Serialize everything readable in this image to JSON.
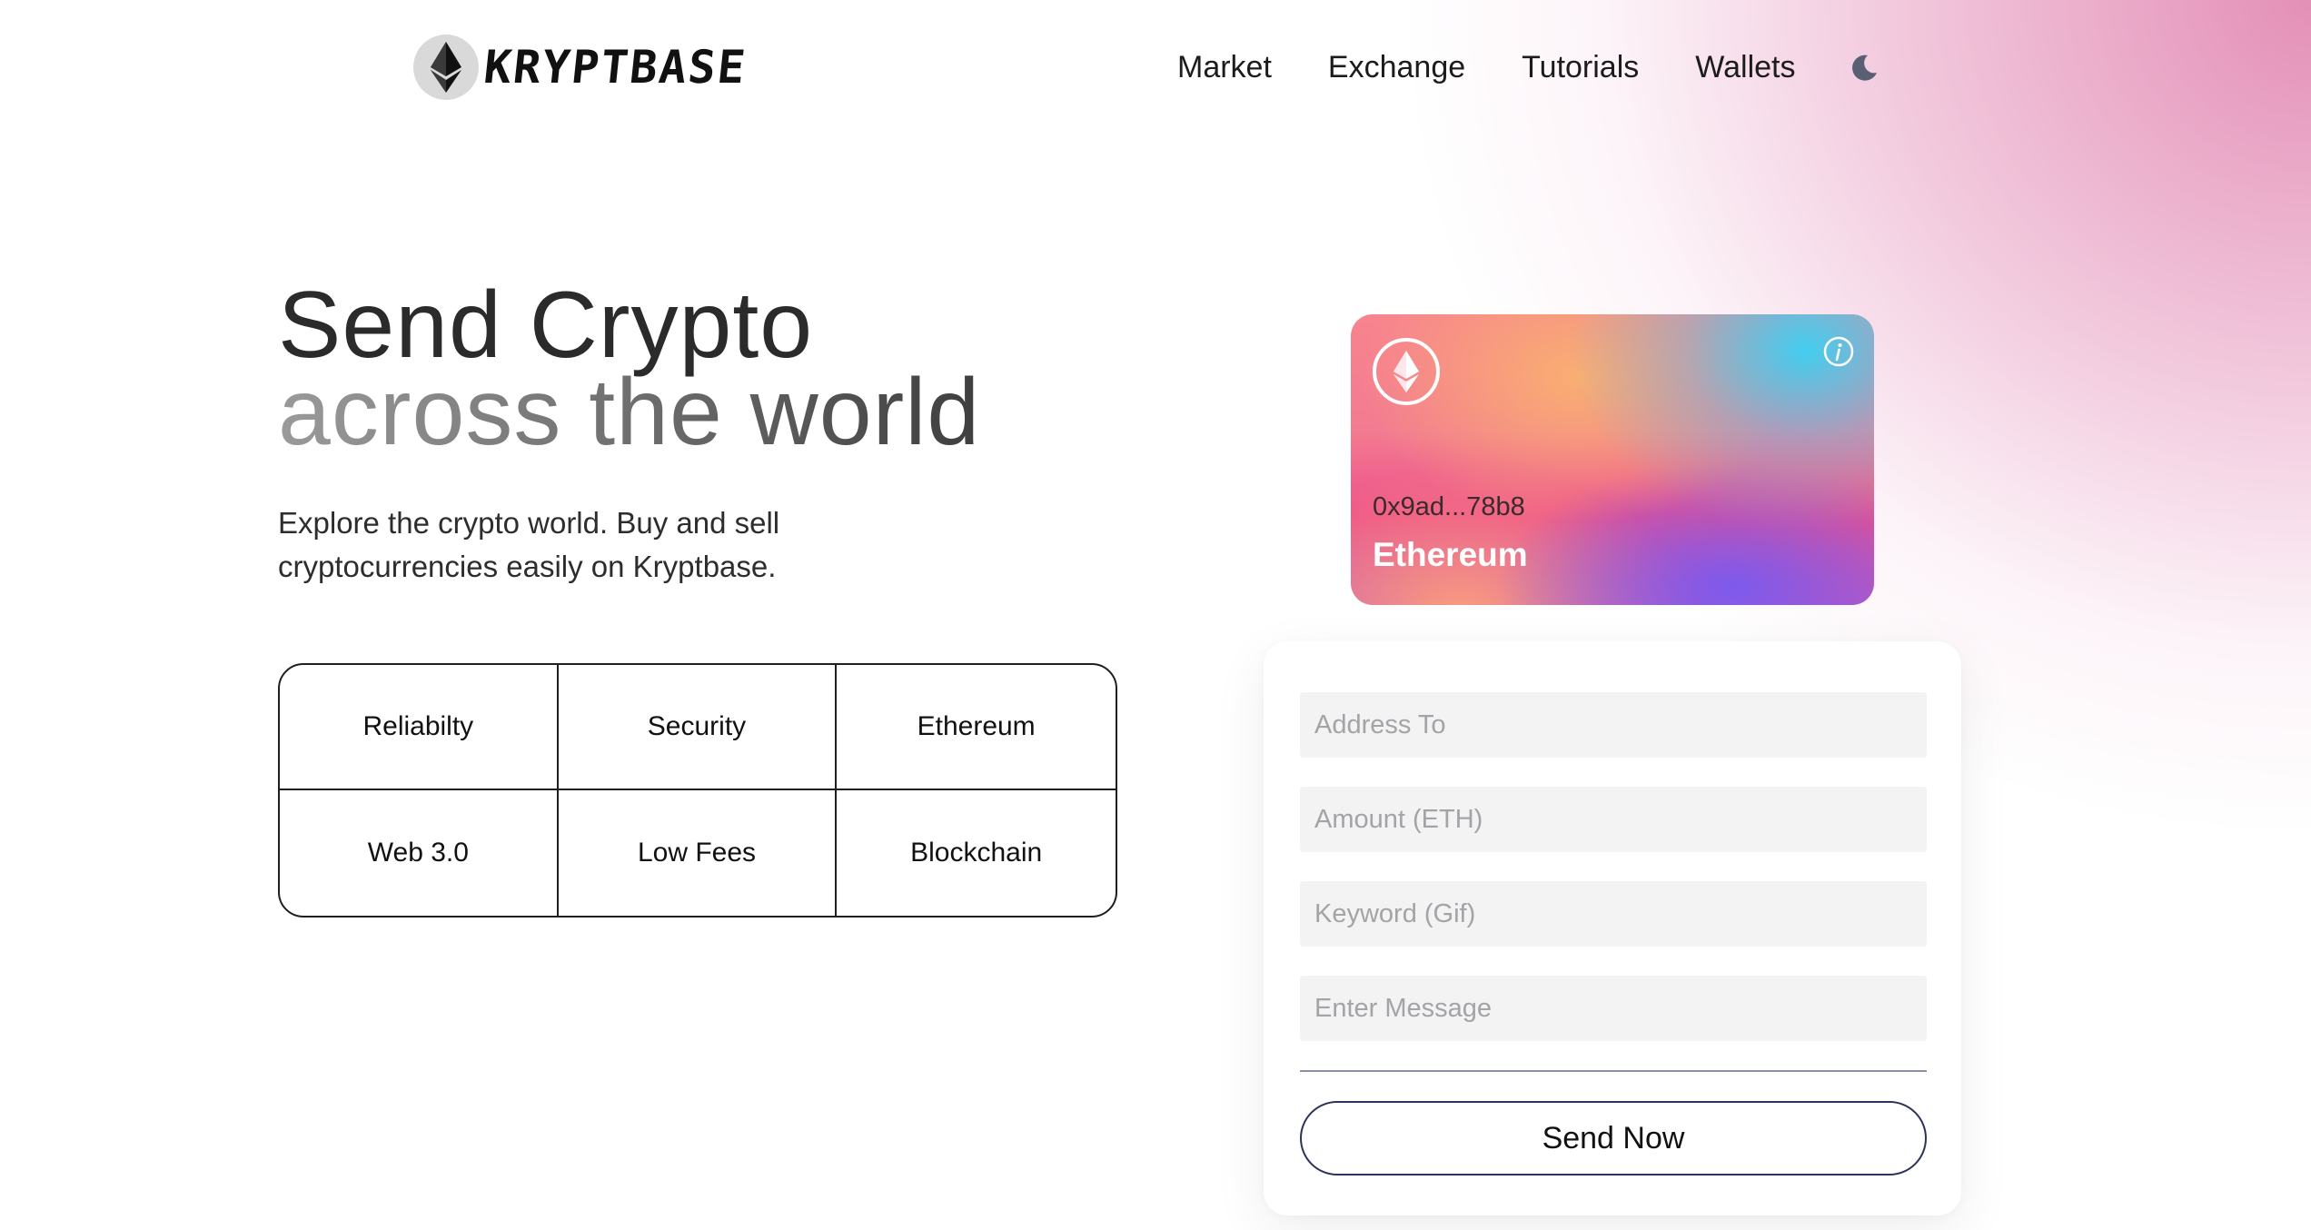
{
  "header": {
    "logo_text": "KRYPTBASE",
    "logo_icon": "ethereum-icon",
    "nav": [
      {
        "label": "Market"
      },
      {
        "label": "Exchange"
      },
      {
        "label": "Tutorials"
      },
      {
        "label": "Wallets"
      }
    ],
    "theme_toggle_icon": "moon-icon"
  },
  "hero": {
    "title_line1": "Send Crypto",
    "title_line2": "across the world",
    "subtitle": "Explore the crypto world. Buy and sell cryptocurrencies easily on Kryptbase."
  },
  "features": [
    {
      "label": "Reliabilty"
    },
    {
      "label": "Security"
    },
    {
      "label": "Ethereum"
    },
    {
      "label": "Web 3.0"
    },
    {
      "label": "Low Fees"
    },
    {
      "label": "Blockchain"
    }
  ],
  "card": {
    "address": "0x9ad...78b8",
    "network": "Ethereum",
    "icon": "ethereum-icon",
    "info_icon": "info-icon"
  },
  "form": {
    "address_placeholder": "Address To",
    "amount_placeholder": "Amount (ETH)",
    "keyword_placeholder": "Keyword (Gif)",
    "message_placeholder": "Enter Message",
    "submit_label": "Send Now"
  },
  "colors": {
    "accent_pink": "#df7caa",
    "button_border": "#2d3358",
    "input_bg": "#f3f3f3"
  }
}
